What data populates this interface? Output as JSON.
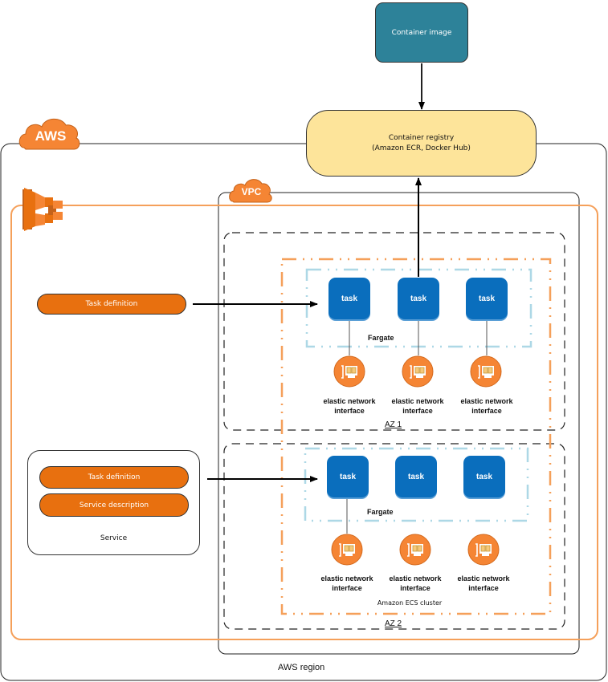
{
  "diagram": {
    "container_image": {
      "label": "Container image",
      "color": "#2d8299"
    },
    "container_registry": {
      "line1": "Container registry",
      "line2": "(Amazon ECR, Docker Hub)",
      "color": "#fde49a"
    },
    "aws_badge": {
      "label": "AWS",
      "color": "#f58534"
    },
    "vpc_badge": {
      "label": "VPC",
      "color": "#f58534"
    },
    "ecs_icon": {
      "icon": "amazon-ecs-icon",
      "color": "#e8700f"
    },
    "task_definition_standalone": {
      "label": "Task definition"
    },
    "service": {
      "label": "Service",
      "task_definition": "Task definition",
      "service_description": "Service description"
    },
    "az1": {
      "label": "AZ 1",
      "fargate_label": "Fargate",
      "tasks": [
        "task",
        "task",
        "task"
      ],
      "enis": [
        {
          "line1": "elastic network",
          "line2": "interface"
        },
        {
          "line1": "elastic network",
          "line2": "interface"
        },
        {
          "line1": "elastic network",
          "line2": "interface"
        }
      ]
    },
    "az2": {
      "label": "AZ 2",
      "fargate_label": "Fargate",
      "tasks": [
        "task",
        "task",
        "task"
      ],
      "enis": [
        {
          "line1": "elastic network",
          "line2": "interface"
        },
        {
          "line1": "elastic network",
          "line2": "interface"
        },
        {
          "line1": "elastic network",
          "line2": "interface"
        }
      ]
    },
    "ecs_cluster_label": "Amazon ECS cluster",
    "region_label": "AWS region",
    "colors": {
      "task": "#0a6ebd",
      "eni": "#f58534",
      "pill": "#e8700f",
      "cluster_border": "#f5a05a",
      "fargate_border": "#add8e6"
    }
  }
}
